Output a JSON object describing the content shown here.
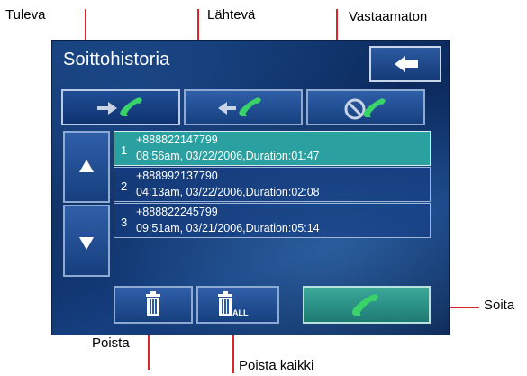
{
  "callouts": {
    "incoming": "Tuleva",
    "outgoing": "Lähtevä",
    "missed": "Vastaamaton",
    "call": "Soita",
    "delete": "Poista",
    "delete_all": "Poista kaikki"
  },
  "screen": {
    "title": "Soittohistoria"
  },
  "call_log": [
    {
      "index": "1",
      "number": "+888822147799",
      "details": "08:56am, 03/22/2006,Duration:01:47"
    },
    {
      "index": "2",
      "number": "+888992137790",
      "details": "04:13am, 03/22/2006,Duration:02:08"
    },
    {
      "index": "3",
      "number": "+888822245799",
      "details": "09:51am, 03/21/2006,Duration:05:14"
    }
  ],
  "icons": {
    "back": "left-arrow-icon",
    "incoming": "incoming-call-icon",
    "outgoing": "outgoing-call-icon",
    "missed": "missed-call-icon",
    "up": "up-arrow-icon",
    "down": "down-arrow-icon",
    "delete": "trash-icon",
    "delete_all": "trash-all-icon",
    "call": "phone-handset-icon"
  },
  "colors": {
    "background": "#0b2a5c",
    "selected_row": "#2aa0a0",
    "call_button": "#2f9486",
    "handset": "#39d36a",
    "leader_line": "#d8262a"
  }
}
